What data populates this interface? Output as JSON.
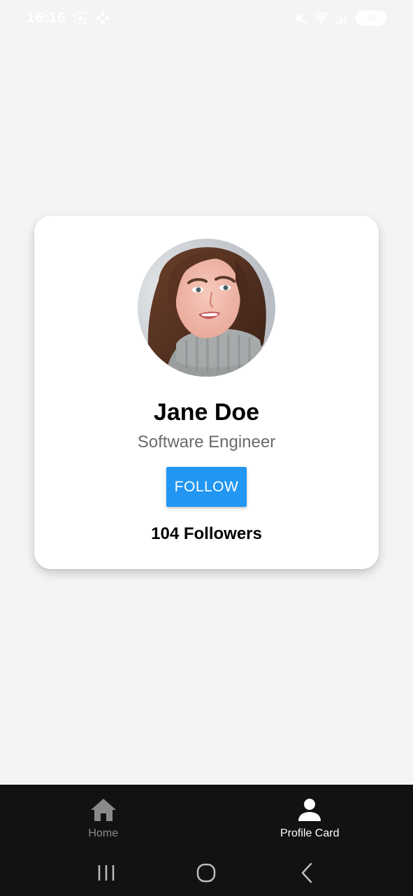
{
  "status_bar": {
    "time": "16:16",
    "battery": "44",
    "icons": [
      "screenshot-icon",
      "pinwheel-icon",
      "mute-icon",
      "wifi-icon",
      "signal-icon",
      "battery-icon"
    ]
  },
  "profile": {
    "name": "Jane Doe",
    "title": "Software Engineer",
    "follow_label": "FOLLOW",
    "followers": "104 Followers",
    "avatar_icon": "profile-photo"
  },
  "bottom_nav": {
    "items": [
      {
        "label": "Home",
        "icon": "home-icon",
        "active": false
      },
      {
        "label": "Profile Card",
        "icon": "person-icon",
        "active": true
      }
    ]
  },
  "system_nav": {
    "buttons": [
      "recents-icon",
      "home-circle-icon",
      "back-icon"
    ]
  },
  "colors": {
    "background": "#f4f4f4",
    "accent": "#2196f3",
    "nav_background": "#121212",
    "subtitle": "#6a6a6a"
  }
}
